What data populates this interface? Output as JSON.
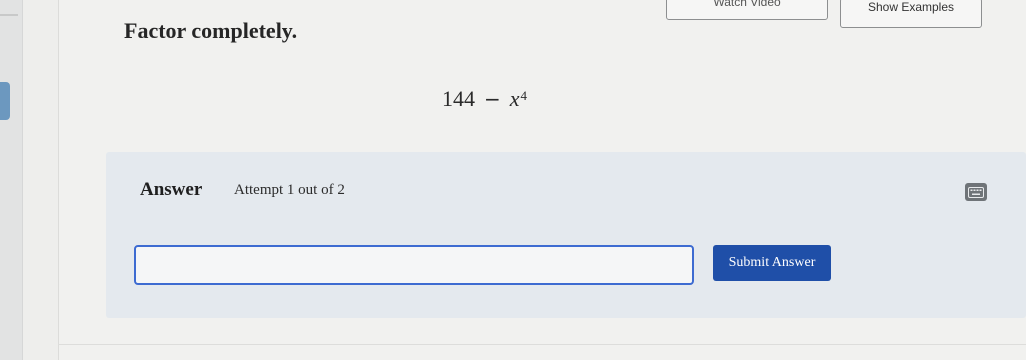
{
  "toolbar": {
    "video_label": "Watch Video",
    "examples_label": "Show Examples"
  },
  "question": {
    "prompt": "Factor completely.",
    "expression": {
      "constant": "144",
      "operator": "−",
      "variable": "x",
      "exponent": "4"
    }
  },
  "answer": {
    "label": "Answer",
    "attempt_text": "Attempt 1 out of 2",
    "input_value": "",
    "submit_label": "Submit Answer"
  },
  "icons": {
    "keyboard": "keyboard-icon"
  },
  "colors": {
    "accent": "#1f4fa8",
    "input_border": "#3d6bd1",
    "panel_bg": "#e4e9ee"
  }
}
